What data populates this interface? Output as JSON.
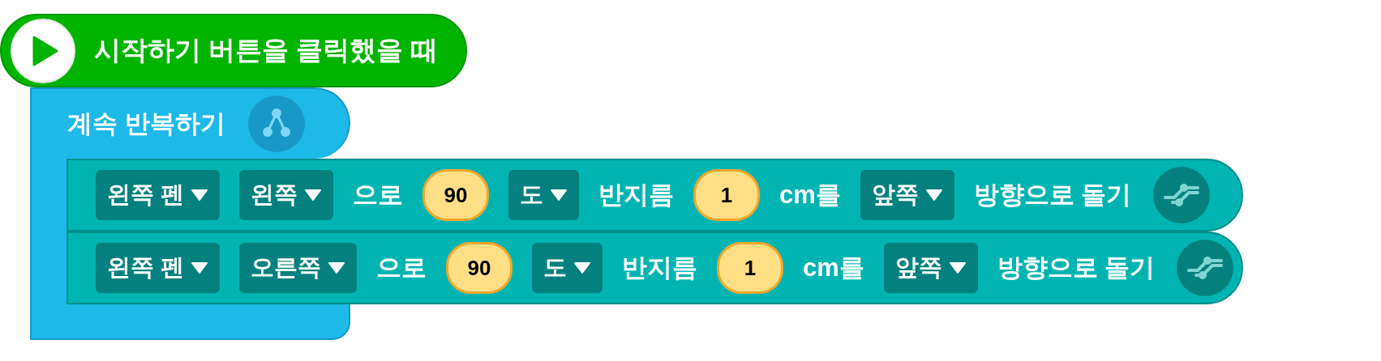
{
  "start_block": {
    "label": "시작하기 버튼을 클릭했을 때"
  },
  "loop_block": {
    "label": "계속 반복하기",
    "statements": [
      {
        "parts": [
          {
            "kind": "dropdown",
            "text": "왼쪽 펜"
          },
          {
            "kind": "dropdown",
            "text": "왼쪽"
          },
          {
            "kind": "text",
            "text": "으로"
          },
          {
            "kind": "number",
            "text": "90"
          },
          {
            "kind": "dropdown",
            "text": "도"
          },
          {
            "kind": "text",
            "text": "반지름"
          },
          {
            "kind": "number",
            "text": "1"
          },
          {
            "kind": "text",
            "text": "cm를"
          },
          {
            "kind": "dropdown",
            "text": "앞쪽"
          },
          {
            "kind": "text",
            "text": "방향으로 돌기"
          }
        ]
      },
      {
        "parts": [
          {
            "kind": "dropdown",
            "text": "왼쪽 펜"
          },
          {
            "kind": "dropdown",
            "text": "오른쪽"
          },
          {
            "kind": "text",
            "text": "으로"
          },
          {
            "kind": "number",
            "text": "90"
          },
          {
            "kind": "dropdown",
            "text": "도"
          },
          {
            "kind": "text",
            "text": "반지름"
          },
          {
            "kind": "number",
            "text": "1"
          },
          {
            "kind": "text",
            "text": "cm를"
          },
          {
            "kind": "dropdown",
            "text": "앞쪽"
          },
          {
            "kind": "text",
            "text": "방향으로 돌기"
          }
        ]
      }
    ]
  }
}
